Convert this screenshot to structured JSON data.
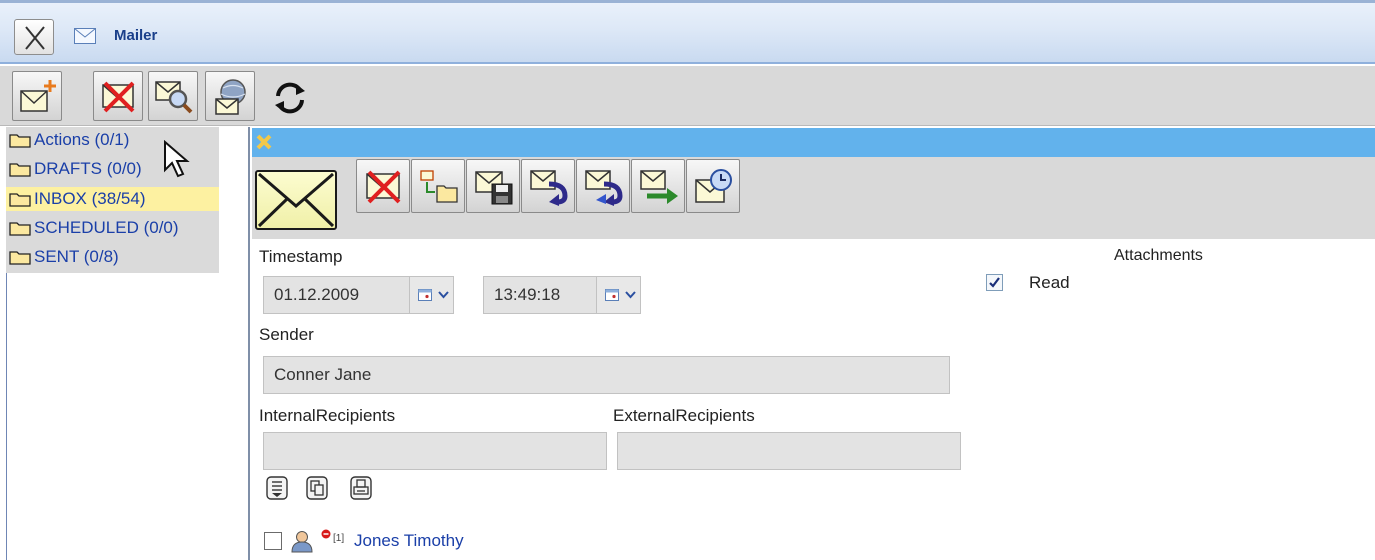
{
  "window": {
    "title": "Mailer",
    "close_icon": "close-icon",
    "app_icon": "envelope-icon"
  },
  "main_toolbar": {
    "buttons": [
      {
        "name": "new-mail-button",
        "icon": "new-mail-icon"
      },
      {
        "name": "delete-mail-button",
        "icon": "delete-mail-icon"
      },
      {
        "name": "search-mail-button",
        "icon": "search-mail-icon"
      },
      {
        "name": "global-mail-button",
        "icon": "globe-mail-icon"
      },
      {
        "name": "refresh-button",
        "icon": "refresh-icon"
      }
    ]
  },
  "folders": [
    {
      "label": "Actions (0/1)",
      "selected": false
    },
    {
      "label": "DRAFTS (0/0)",
      "selected": false
    },
    {
      "label": "INBOX (38/54)",
      "selected": true
    },
    {
      "label": "SCHEDULED (0/0)",
      "selected": false
    },
    {
      "label": "SENT (0/8)",
      "selected": false
    }
  ],
  "message_toolbar": {
    "buttons": [
      {
        "name": "delete-message-button",
        "icon": "delete-mail-icon"
      },
      {
        "name": "move-to-folder-button",
        "icon": "move-folder-icon"
      },
      {
        "name": "save-message-button",
        "icon": "save-mail-icon"
      },
      {
        "name": "reply-button",
        "icon": "reply-icon"
      },
      {
        "name": "reply-all-button",
        "icon": "reply-all-icon"
      },
      {
        "name": "forward-button",
        "icon": "forward-icon"
      },
      {
        "name": "schedule-button",
        "icon": "schedule-mail-icon"
      }
    ]
  },
  "form": {
    "timestamp_label": "Timestamp",
    "date_value": "01.12.2009",
    "time_value": "13:49:18",
    "read_label": "Read",
    "read_checked": true,
    "attachments_label": "Attachments",
    "sender_label": "Sender",
    "sender_value": "Conner Jane",
    "internal_recipients_label": "InternalRecipients",
    "internal_recipients_value": "",
    "external_recipients_label": "ExternalRecipients",
    "external_recipients_value": ""
  },
  "recipient_tools": [
    "select-all-icon",
    "copy-icon",
    "print-icon"
  ],
  "recipients": [
    {
      "marker": "[1]",
      "name": "Jones Timothy",
      "checked": false
    }
  ],
  "colors": {
    "accent_strip": "#62b2ec",
    "selected_folder": "#fdf1a1",
    "link": "#1a3fa8"
  }
}
